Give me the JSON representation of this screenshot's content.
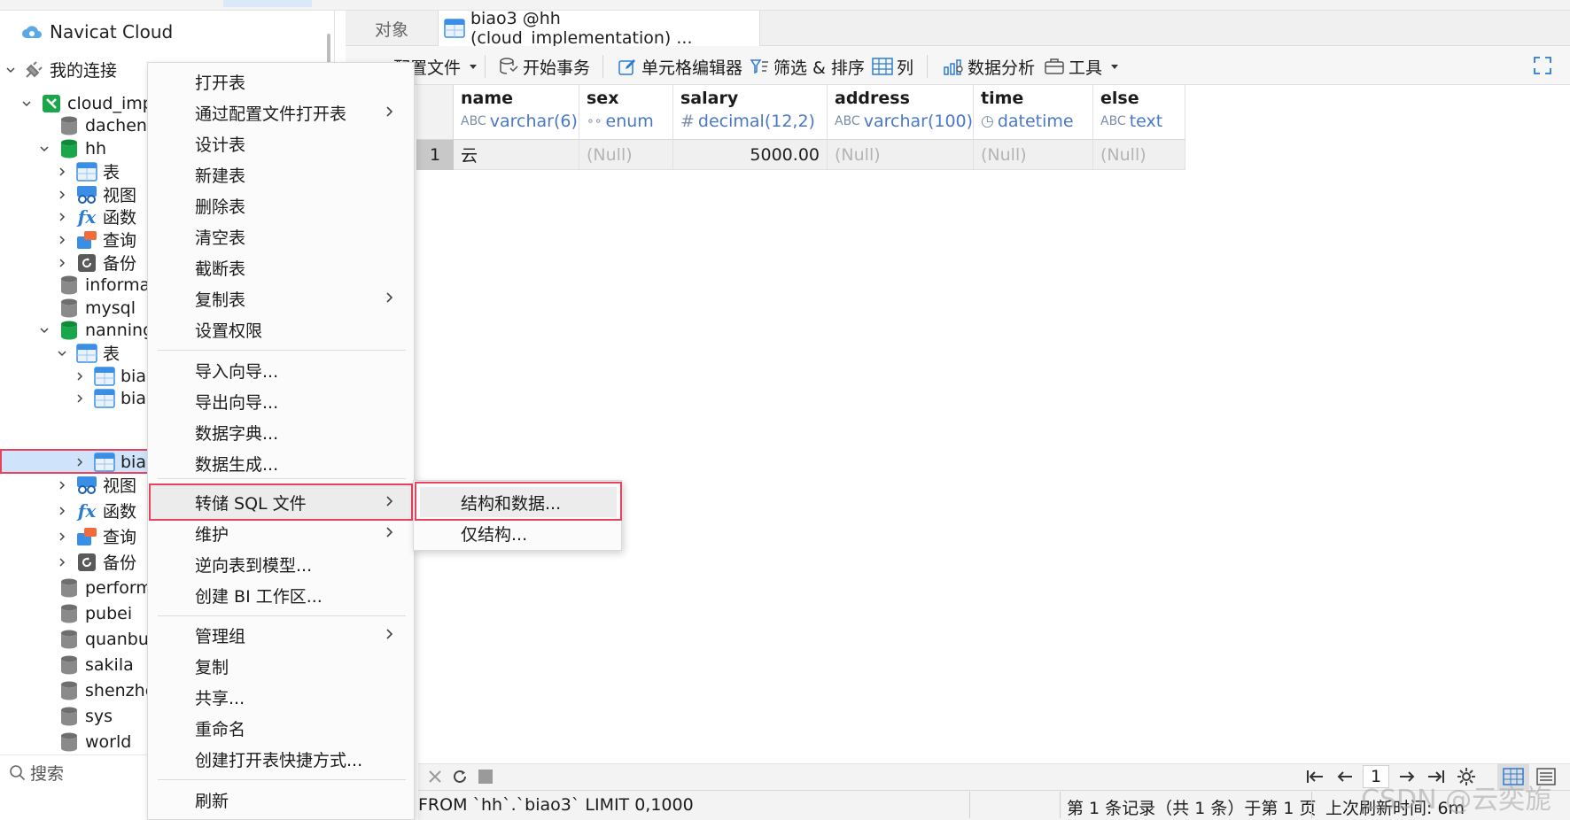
{
  "nav": {
    "cloud_label": "Navicat Cloud",
    "my_connections": "我的连接",
    "search_placeholder": "搜索",
    "items": {
      "cloud_impl": "cloud_imp",
      "dachen": "dachen",
      "hh": "hh",
      "hh_tables": "表",
      "hh_views": "视图",
      "hh_funcs": "函数",
      "hh_queries": "查询",
      "hh_backups": "备份",
      "information": "informa",
      "mysql": "mysql",
      "nanning": "nanning",
      "nn_tables": "表",
      "t1": "bia",
      "t2": "bia",
      "t3": "bia",
      "nn_views": "视图",
      "nn_funcs": "函数",
      "nn_queries": "查询",
      "nn_backups": "备份",
      "performance": "perform",
      "pubei": "pubei",
      "quanbu": "quanbu",
      "sakila": "sakila",
      "shenzhen": "shenzhe",
      "sys": "sys",
      "world": "world"
    }
  },
  "tabs": {
    "objects": "对象",
    "active": "biao3 @hh (cloud_implementation) ..."
  },
  "toolbar": {
    "profile": "配置文件",
    "begin_tx": "开始事务",
    "cell_editor": "单元格编辑器",
    "filter_sort": "筛选 & 排序",
    "columns": "列",
    "data_analysis": "数据分析",
    "tools": "工具"
  },
  "grid": {
    "columns": [
      {
        "name": "name",
        "type": "varchar(6)",
        "type_icon": "abc-icon"
      },
      {
        "name": "sex",
        "type": "enum",
        "type_icon": "enum-icon"
      },
      {
        "name": "salary",
        "type": "decimal(12,2)",
        "type_icon": "hash-icon"
      },
      {
        "name": "address",
        "type": "varchar(100)",
        "type_icon": "abc-icon"
      },
      {
        "name": "time",
        "type": "datetime",
        "type_icon": "clock-icon"
      },
      {
        "name": "else",
        "type": "text",
        "type_icon": "abc-icon"
      }
    ],
    "row": {
      "num": "1",
      "name": "云",
      "sex": "(Null)",
      "salary": "5000.00",
      "address": "(Null)",
      "time": "(Null)",
      "else": "(Null)"
    }
  },
  "context_menu": {
    "open_table": "打开表",
    "open_with_profile": "通过配置文件打开表",
    "design_table": "设计表",
    "new_table": "新建表",
    "delete_table": "删除表",
    "empty_table": "清空表",
    "truncate_table": "截断表",
    "copy_table": "复制表",
    "set_permissions": "设置权限",
    "import_wizard": "导入向导...",
    "export_wizard": "导出向导...",
    "data_dictionary": "数据字典...",
    "data_generation": "数据生成...",
    "dump_sql": "转储 SQL 文件",
    "maintain": "维护",
    "reverse_to_model": "逆向表到模型...",
    "create_bi": "创建 BI 工作区...",
    "manage_group": "管理组",
    "copy": "复制",
    "share": "共享...",
    "rename": "重命名",
    "create_shortcut": "创建打开表快捷方式...",
    "refresh": "刷新"
  },
  "submenu": {
    "structure_and_data": "结构和数据...",
    "structure_only": "仅结构..."
  },
  "pager": {
    "page": "1"
  },
  "status": {
    "sql": "FROM `hh`.`biao3` LIMIT 0,1000",
    "records": "第 1 条记录（共 1 条）于第 1 页",
    "last_refresh": "上次刷新时间: 6m"
  },
  "watermark": "CSDN @云奕旎",
  "colors": {
    "selection": "#cfe3fb",
    "highlight_border": "#e8425c",
    "type_text": "#4a78c6",
    "db_green": "#1aa64a",
    "db_grey": "#7b7b7b",
    "table_blue": "#3a8ee6"
  }
}
